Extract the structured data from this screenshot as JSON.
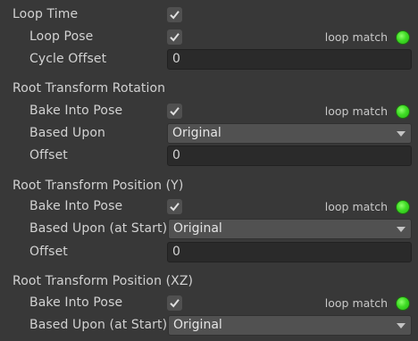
{
  "loop_time": {
    "label": "Loop Time",
    "checked": true
  },
  "loop_pose": {
    "label": "Loop Pose",
    "checked": true,
    "match_label": "loop match",
    "match_color": "#3fdc25"
  },
  "cycle_offset": {
    "label": "Cycle Offset",
    "value": "0"
  },
  "root_rotation": {
    "title": "Root Transform Rotation",
    "bake_label": "Bake Into Pose",
    "bake_checked": true,
    "match_label": "loop match",
    "based_upon_label": "Based Upon",
    "based_upon_value": "Original",
    "offset_label": "Offset",
    "offset_value": "0"
  },
  "root_position_y": {
    "title": "Root Transform Position (Y)",
    "bake_label": "Bake Into Pose",
    "bake_checked": true,
    "match_label": "loop match",
    "based_upon_label": "Based Upon (at Start)",
    "based_upon_value": "Original",
    "offset_label": "Offset",
    "offset_value": "0"
  },
  "root_position_xz": {
    "title": "Root Transform Position (XZ)",
    "bake_label": "Bake Into Pose",
    "bake_checked": true,
    "match_label": "loop match",
    "based_upon_label": "Based Upon (at Start)",
    "based_upon_value": "Original"
  },
  "icons": {
    "checkmark": "checkmark-icon",
    "dropdown_arrow": "chevron-down-icon",
    "match_indicator": "green-status-light"
  },
  "colors": {
    "background": "#383838",
    "text": "#d2d2d2",
    "field_bg": "#2a2a2a",
    "dropdown_bg": "#515151",
    "indicator_green": "#3fdc25"
  }
}
